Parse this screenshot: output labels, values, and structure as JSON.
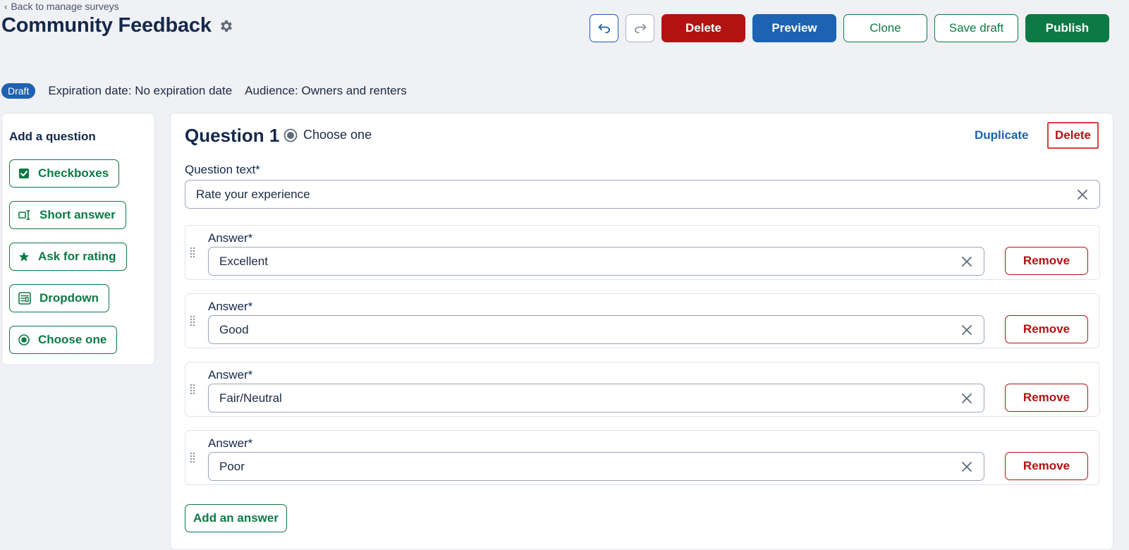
{
  "header": {
    "back_link": "Back to manage surveys",
    "title": "Community Feedback"
  },
  "toolbar": {
    "undo_icon": "undo-icon",
    "redo_icon": "redo-icon",
    "delete_label": "Delete",
    "preview_label": "Preview",
    "clone_label": "Clone",
    "save_draft_label": "Save draft",
    "publish_label": "Publish"
  },
  "meta": {
    "status_badge": "Draft",
    "expiration": "Expiration date: No expiration date",
    "audience": "Audience: Owners and renters"
  },
  "sidebar": {
    "heading": "Add a question",
    "items": [
      {
        "label": "Checkboxes",
        "icon": "checkbox-icon"
      },
      {
        "label": "Short answer",
        "icon": "text-cursor-icon"
      },
      {
        "label": "Ask for rating",
        "icon": "star-icon"
      },
      {
        "label": "Dropdown",
        "icon": "dropdown-list-icon"
      },
      {
        "label": "Choose one",
        "icon": "radio-icon"
      }
    ]
  },
  "question": {
    "title": "Question 1",
    "type_label": "Choose one",
    "duplicate_label": "Duplicate",
    "delete_label": "Delete",
    "text_label": "Question text*",
    "text_value": "Rate your experience",
    "answer_label": "Answer*",
    "answers": [
      "Excellent",
      "Good",
      "Fair/Neutral",
      "Poor"
    ],
    "remove_label": "Remove",
    "add_answer_label": "Add an answer"
  },
  "colors": {
    "green": "#0d7a46",
    "blue": "#1d62b3",
    "red": "#b31212",
    "highlight": "#e03d3d"
  }
}
